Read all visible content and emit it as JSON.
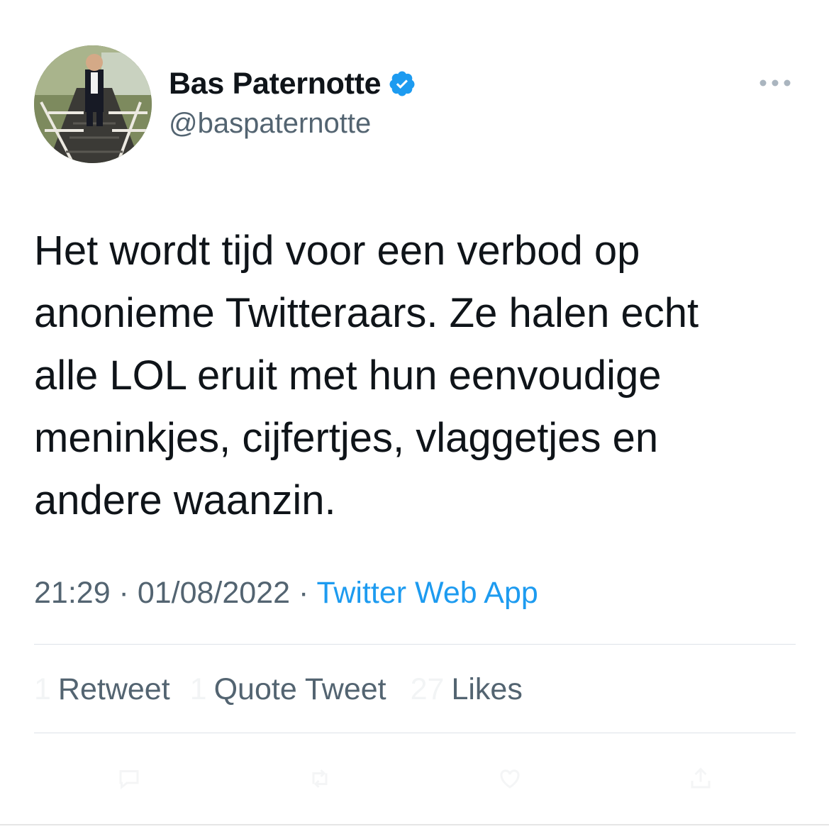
{
  "author": {
    "display_name": "Bas Paternotte",
    "handle": "@baspaternotte",
    "verified": true,
    "verified_color": "#1d9bf0"
  },
  "tweet": {
    "text": "Het wordt tijd voor een verbod op\nanonieme Twitteraars. Ze halen echt\nalle LOL eruit met hun eenvoudige\nmeninkjes, cijfertjes, vlaggetjes en\nandere waanzin."
  },
  "meta": {
    "time": "21:29",
    "separator": " · ",
    "date": "01/08/2022",
    "source": "Twitter Web App"
  },
  "stats": {
    "retweets": {
      "count": "1",
      "label": "Retweet"
    },
    "quotes": {
      "count": "1",
      "label": "Quote Tweet"
    },
    "likes": {
      "count": "27",
      "label": "Likes"
    }
  },
  "icons": {
    "more": "more-horizontal-icon",
    "verified": "verified-badge-icon",
    "reply": "reply-icon",
    "retweet": "retweet-icon",
    "like": "heart-icon",
    "share": "share-icon"
  },
  "colors": {
    "text": "#0f1419",
    "secondary": "#536471",
    "link": "#1d9bf0",
    "divider": "#dde3e8"
  }
}
